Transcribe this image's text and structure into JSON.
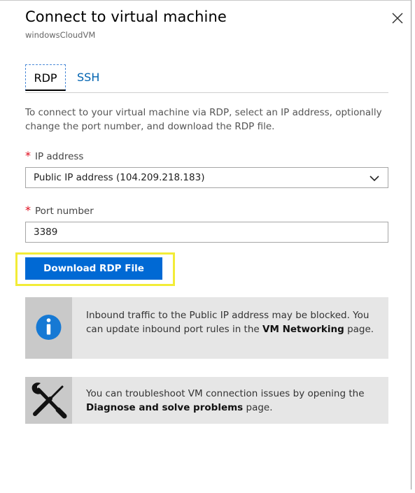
{
  "panel": {
    "title": "Connect to virtual machine",
    "subtitle": "windowsCloudVM"
  },
  "tabs": [
    {
      "label": "RDP",
      "selected": true
    },
    {
      "label": "SSH",
      "selected": false
    }
  ],
  "description": "To connect to your virtual machine via RDP, select an IP address, optionally change the port number, and download the RDP file.",
  "ip_address": {
    "label": "IP address",
    "required_mark": "*",
    "selected": "Public IP address (104.209.218.183)"
  },
  "port": {
    "label": "Port number",
    "required_mark": "*",
    "value": "3389"
  },
  "download_button": "Download RDP File",
  "notices": {
    "info": {
      "icon": "info-icon",
      "text_before": "Inbound traffic to the Public IP address may be blocked. You can update inbound port rules in the ",
      "link": "VM Networking",
      "text_after": " page."
    },
    "troubleshoot": {
      "icon": "tools-icon",
      "text_before": "You can troubleshoot VM connection issues by opening the ",
      "link": "Diagnose and solve problems",
      "text_after": " page."
    }
  },
  "colors": {
    "accent": "#0069d4",
    "link": "#0063b1",
    "required": "#e00b1c",
    "highlight": "#f2ec37",
    "info_icon": "#1679d4"
  }
}
